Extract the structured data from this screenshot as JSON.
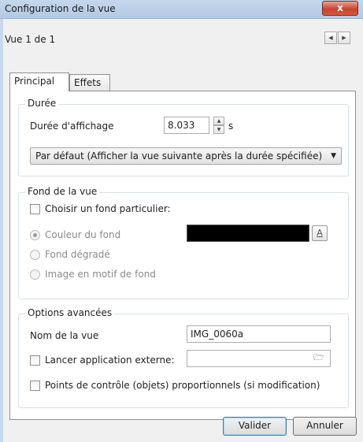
{
  "window": {
    "title": "Configuration de la vue",
    "close_label": "x"
  },
  "header": {
    "page_label": "Vue 1 de 1",
    "prev_icon": "triangle-left",
    "next_icon": "triangle-right"
  },
  "tabs": [
    {
      "label": "Principal",
      "selected": true
    },
    {
      "label": "Effets",
      "selected": false
    }
  ],
  "duration": {
    "group_label": "Durée",
    "display_label": "Durée d'affichage",
    "display_value": "8.033",
    "unit": "s",
    "mode_selected": "Par défaut (Afficher la vue suivante après la durée spécifiée)"
  },
  "background": {
    "group_label": "Fond de la vue",
    "custom_checkbox_label": "Choisir un fond particulier:",
    "custom_checked": false,
    "options": [
      {
        "label": "Couleur du fond",
        "checked": true
      },
      {
        "label": "Fond dégradé",
        "checked": false
      },
      {
        "label": "Image en motif de fond",
        "checked": false
      }
    ],
    "color_value": "#000000",
    "color_button_icon": "underlined-a-icon",
    "color_button_glyph": "A"
  },
  "advanced": {
    "group_label": "Options avancées",
    "name_label": "Nom de la vue",
    "name_value": "IMG_0060a",
    "external_app_label": "Lancer application externe:",
    "external_app_checked": false,
    "external_app_value": "",
    "browse_icon": "folder-icon",
    "control_points_label": "Points de contrôle (objets) proportionnels (si modification)",
    "control_points_checked": false
  },
  "footer": {
    "ok_label": "Valider",
    "cancel_label": "Annuler"
  },
  "colors": {
    "titlebar": "#b3cae4",
    "close": "#c7452c",
    "panel": "#ffffff",
    "window_bg": "#f0f0f0",
    "default_button_border": "#3c7fb1"
  }
}
